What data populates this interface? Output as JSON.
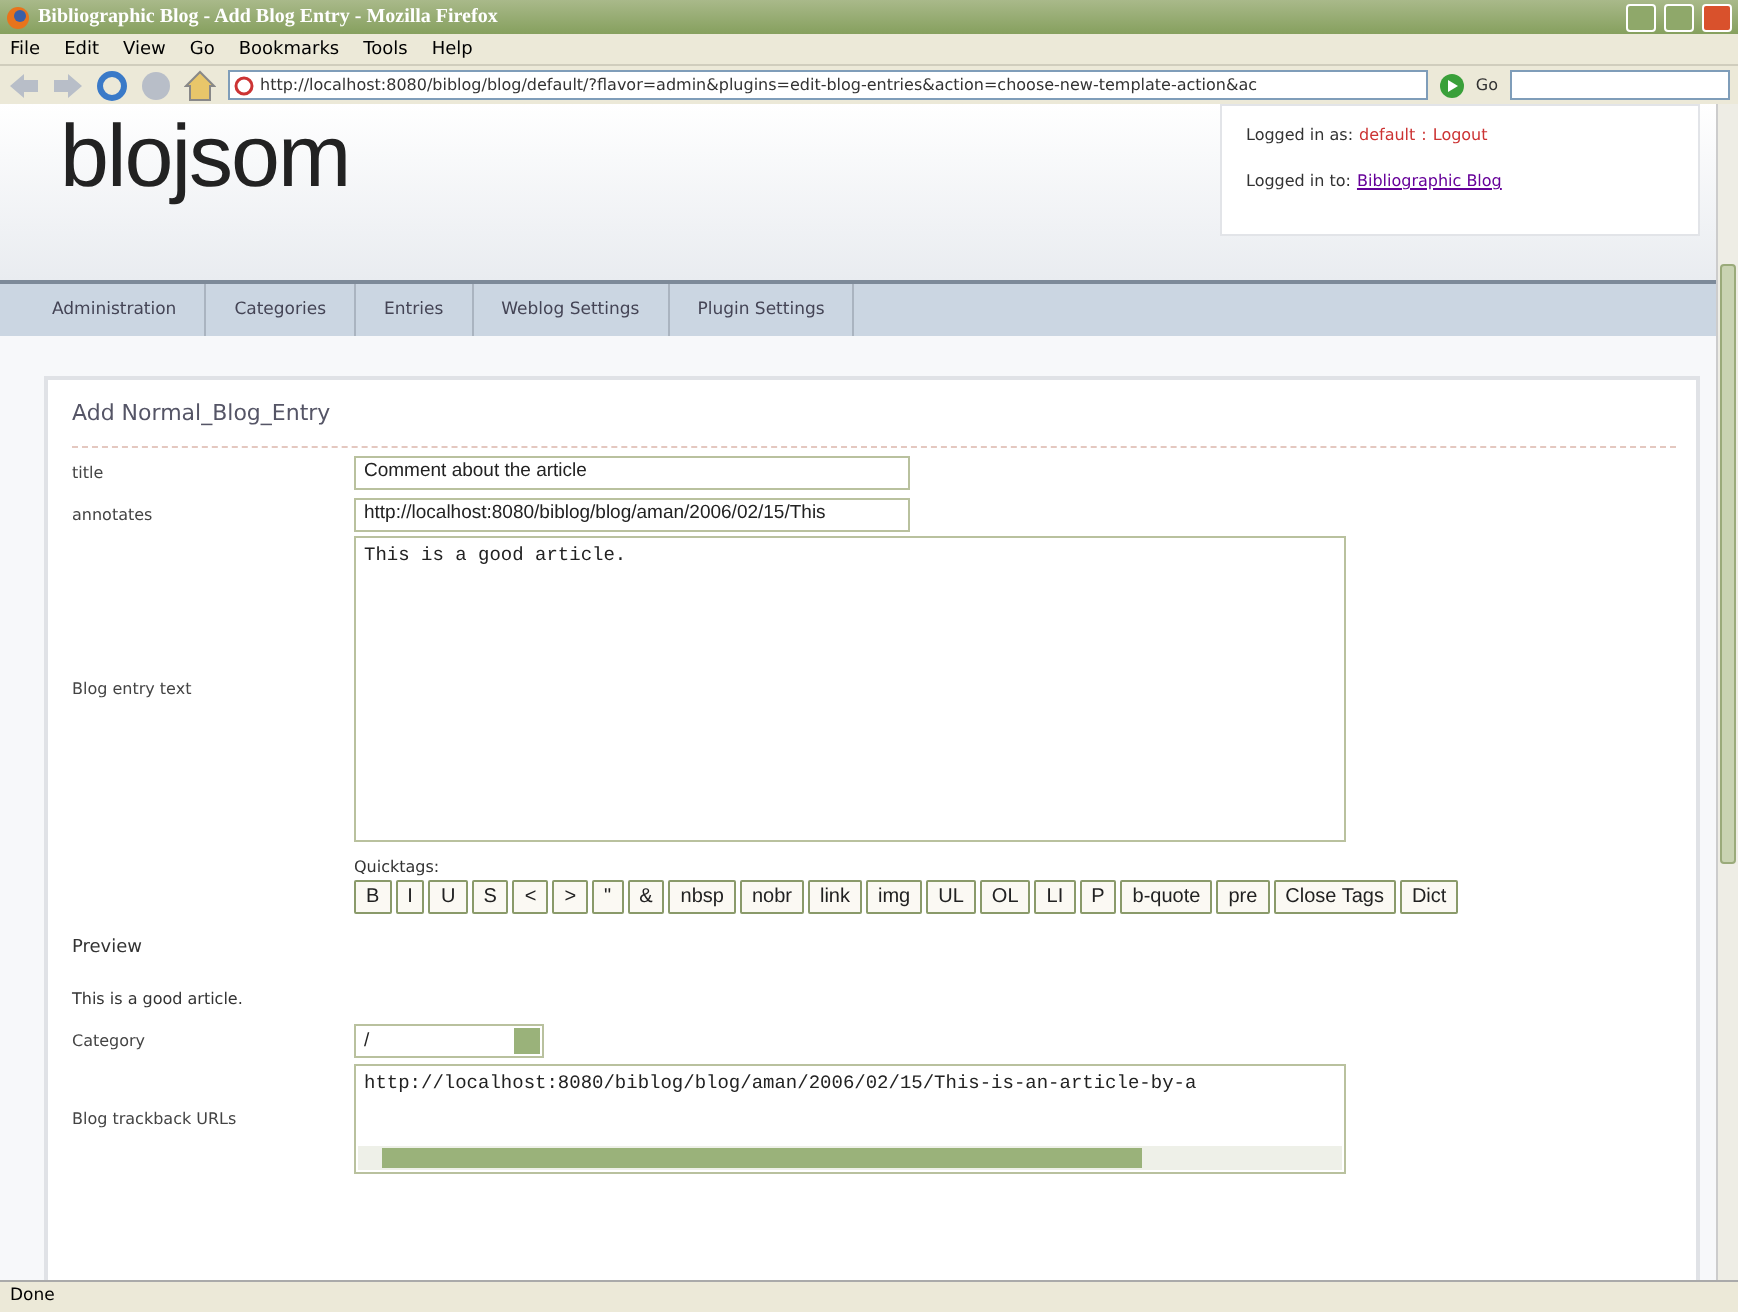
{
  "window": {
    "title": "Bibliographic Blog - Add Blog Entry - Mozilla Firefox"
  },
  "menu_bar": [
    "File",
    "Edit",
    "View",
    "Go",
    "Bookmarks",
    "Tools",
    "Help"
  ],
  "toolbar": {
    "address": "http://localhost:8080/biblog/blog/default/?flavor=admin&plugins=edit-blog-entries&action=choose-new-template-action&ac",
    "go": "Go"
  },
  "header": {
    "logo": "blojsom",
    "login": {
      "as_label": "Logged in as:",
      "user": "default",
      "separator": ":",
      "logout": "Logout",
      "to_label": "Logged in to:",
      "blog": "Bibliographic Blog"
    }
  },
  "tabs": [
    "Administration",
    "Categories",
    "Entries",
    "Weblog Settings",
    "Plugin Settings"
  ],
  "form": {
    "heading": "Add Normal_Blog_Entry",
    "fields": [
      {
        "kind": "text",
        "label": "title",
        "value": "Comment about the article"
      },
      {
        "kind": "text",
        "label": "annotates",
        "value": "http://localhost:8080/biblog/blog/aman/2006/02/15/This"
      },
      {
        "kind": "textarea",
        "label": "Blog entry text",
        "value": "This is a good article."
      }
    ],
    "quicktags": {
      "label": "Quicktags:",
      "buttons": [
        "B",
        "I",
        "U",
        "S",
        "<",
        ">",
        "\"",
        "&",
        "nbsp",
        "nobr",
        "link",
        "img",
        "UL",
        "OL",
        "LI",
        "P",
        "b-quote",
        "pre",
        "Close Tags",
        "Dict"
      ]
    },
    "preview": {
      "label": "Preview",
      "text": "This is a good article."
    },
    "category": {
      "label": "Category",
      "value": "/"
    },
    "trackback": {
      "label": "Blog trackback URLs",
      "value": "http://localhost:8080/biblog/blog/aman/2006/02/15/This-is-an-article-by-a"
    }
  },
  "status_bar": {
    "text": "Done"
  }
}
